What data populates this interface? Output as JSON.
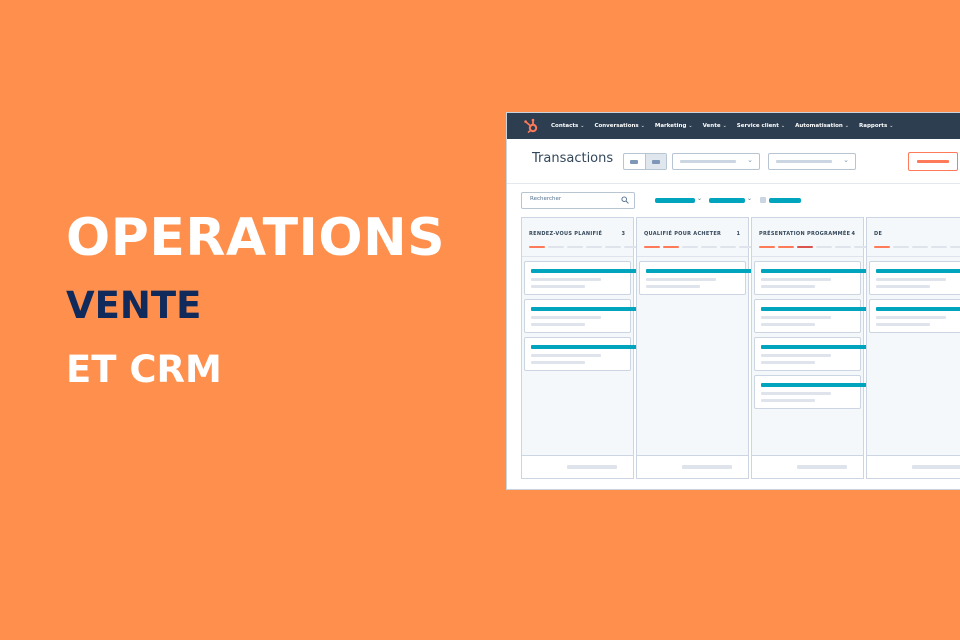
{
  "hero": {
    "line1": "OPERATIONS",
    "line2": "VENTE",
    "line3": "ET CRM"
  },
  "colors": {
    "background": "#FF8F4C",
    "navy": "#102A5C",
    "nav_bar": "#2D3E50",
    "accent_teal": "#00A4BD",
    "accent_orange": "#FF7A59"
  },
  "app": {
    "logo_icon": "hubspot-sprocket-icon",
    "nav": [
      {
        "label": "Contacts"
      },
      {
        "label": "Conversations"
      },
      {
        "label": "Marketing"
      },
      {
        "label": "Vente"
      },
      {
        "label": "Service client"
      },
      {
        "label": "Automatisation"
      },
      {
        "label": "Rapports"
      }
    ],
    "page_title": "Transactions",
    "search_placeholder": "Rechercher",
    "columns": [
      {
        "title": "RENDEZ-VOUS PLANIFIÉ",
        "count": "3"
      },
      {
        "title": "QUALIFIÉ POUR ACHETER",
        "count": "1"
      },
      {
        "title": "PRÉSENTATION PROGRAMMÉE",
        "count": "4"
      },
      {
        "title": "DE",
        "count": ""
      }
    ]
  }
}
